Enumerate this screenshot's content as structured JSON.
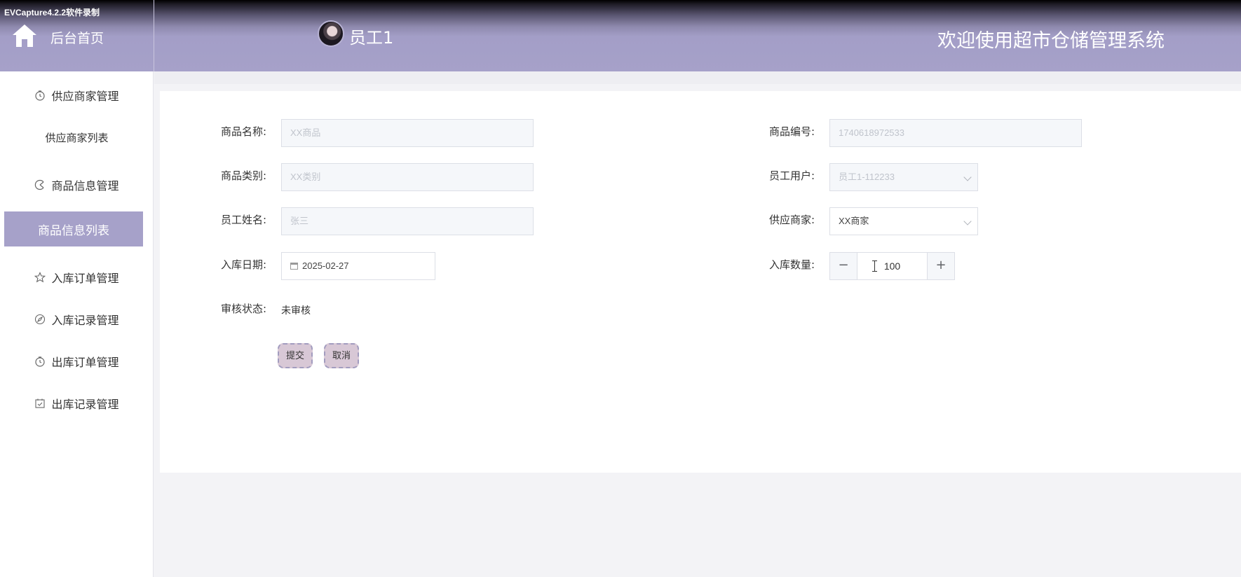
{
  "capture_label": "EVCapture4.2.2软件录制",
  "header": {
    "home_label": "后台首页",
    "user_name": "员工1",
    "welcome": "欢迎使用超市仓储管理系统"
  },
  "sidebar": {
    "items": [
      {
        "label": "供应商家管理",
        "icon": "clock-icon"
      },
      {
        "label": "供应商家列表"
      },
      {
        "label": "商品信息管理",
        "icon": "pie-icon"
      },
      {
        "label": "商品信息列表",
        "active": true
      },
      {
        "label": "入库订单管理",
        "icon": "star-icon"
      },
      {
        "label": "入库记录管理",
        "icon": "compass-icon"
      },
      {
        "label": "出库订单管理",
        "icon": "clock-icon"
      },
      {
        "label": "出库记录管理",
        "icon": "calendar-check-icon"
      }
    ]
  },
  "form": {
    "product_name": {
      "label": "商品名称:",
      "placeholder": "XX商品"
    },
    "product_code": {
      "label": "商品编号:",
      "placeholder": "1740618972533"
    },
    "product_category": {
      "label": "商品类别:",
      "placeholder": "XX类别"
    },
    "employee_user": {
      "label": "员工用户:",
      "value": "员工1-112233"
    },
    "employee_name": {
      "label": "员工姓名:",
      "placeholder": "张三"
    },
    "supplier": {
      "label": "供应商家:",
      "value": "XX商家"
    },
    "stock_in_date": {
      "label": "入库日期:",
      "value": "2025-02-27"
    },
    "stock_in_qty": {
      "label": "入库数量:",
      "value": "100",
      "minus": "−",
      "plus": "+"
    },
    "review_status": {
      "label": "审核状态:",
      "value": "未审核"
    },
    "submit_label": "提交",
    "cancel_label": "取消"
  },
  "colors": {
    "accent": "#a6a1c9",
    "button_bg": "#d8c8d6"
  }
}
